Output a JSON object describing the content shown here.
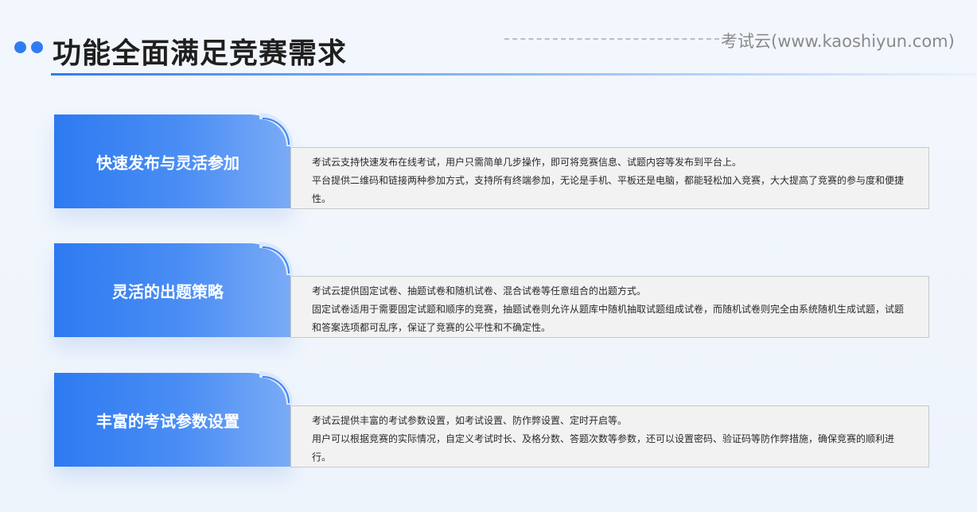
{
  "header": {
    "title": "功能全面满足竞赛需求",
    "brand": "考试云(www.kaoshiyun.com)",
    "accent_color": "#2f7cf2"
  },
  "features": [
    {
      "label": "快速发布与灵活参加",
      "lines": [
        "考试云支持快速发布在线考试，用户只需简单几步操作，即可将竞赛信息、试题内容等发布到平台上。",
        "平台提供二维码和链接两种参加方式，支持所有终端参加，无论是手机、平板还是电脑，都能轻松加入竞赛，大大提高了竞赛的参与度和便捷性。"
      ]
    },
    {
      "label": "灵活的出题策略",
      "lines": [
        "考试云提供固定试卷、抽题试卷和随机试卷、混合试卷等任意组合的出题方式。",
        "固定试卷适用于需要固定试题和顺序的竞赛，抽题试卷则允许从题库中随机抽取试题组成试卷，而随机试卷则完全由系统随机生成试题，试题和答案选项都可乱序，保证了竞赛的公平性和不确定性。"
      ]
    },
    {
      "label": "丰富的考试参数设置",
      "lines": [
        "考试云提供丰富的考试参数设置，如考试设置、防作弊设置、定时开启等。",
        "用户可以根据竞赛的实际情况，自定义考试时长、及格分数、答题次数等参数，还可以设置密码、验证码等防作弊措施，确保竞赛的顺利进行。"
      ]
    }
  ]
}
